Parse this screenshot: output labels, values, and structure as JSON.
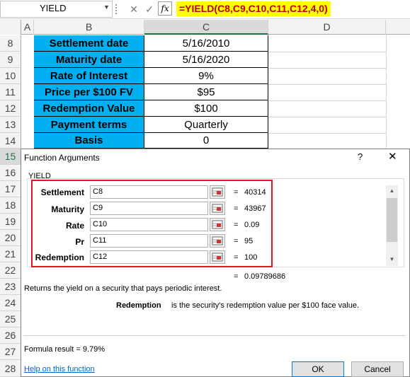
{
  "formula_bar": {
    "name_box": "YIELD",
    "name_arrow": "▼",
    "cancel_icon": "✕",
    "enter_icon": "✓",
    "fx_label": "fx",
    "formula": "=YIELD(C8,C9,C10,C11,C12,4,0)"
  },
  "columns": [
    "A",
    "B",
    "C",
    "D"
  ],
  "rows": [
    {
      "num": "8",
      "label": "Settlement date",
      "value": "5/16/2010"
    },
    {
      "num": "9",
      "label": "Maturity date",
      "value": "5/16/2020"
    },
    {
      "num": "10",
      "label": "Rate of Interest",
      "value": "9%"
    },
    {
      "num": "11",
      "label": "Price per $100 FV",
      "value": "$95"
    },
    {
      "num": "12",
      "label": "Redemption Value",
      "value": "$100"
    },
    {
      "num": "13",
      "label": "Payment terms",
      "value": "Quarterly"
    },
    {
      "num": "14",
      "label": "Basis",
      "value": "0"
    }
  ],
  "hidden_rows": [
    "15",
    "16",
    "17",
    "18",
    "19",
    "20",
    "21",
    "22",
    "23",
    "24",
    "25",
    "26",
    "27",
    "28"
  ],
  "dialog": {
    "title": "Function Arguments",
    "help": "?",
    "close": "✕",
    "function_name": "YIELD",
    "args": [
      {
        "label": "Settlement",
        "input": "C8",
        "eq": "=",
        "value": "40314"
      },
      {
        "label": "Maturity",
        "input": "C9",
        "eq": "=",
        "value": "43967"
      },
      {
        "label": "Rate",
        "input": "C10",
        "eq": "=",
        "value": "0.09"
      },
      {
        "label": "Pr",
        "input": "C11",
        "eq": "=",
        "value": "95"
      },
      {
        "label": "Redemption",
        "input": "C12",
        "eq": "=",
        "value": "100"
      }
    ],
    "result_eq": "=",
    "result_value": "0.09789686",
    "description": "Returns the yield on a security that pays periodic interest.",
    "arg_name": "Redemption",
    "arg_description": "is the security's redemption value per $100 face value.",
    "formula_result": "Formula result =   9.79%",
    "help_link": "Help on this function",
    "ok": "OK",
    "cancel": "Cancel",
    "scroll_up": "▲",
    "scroll_down": "▼"
  }
}
